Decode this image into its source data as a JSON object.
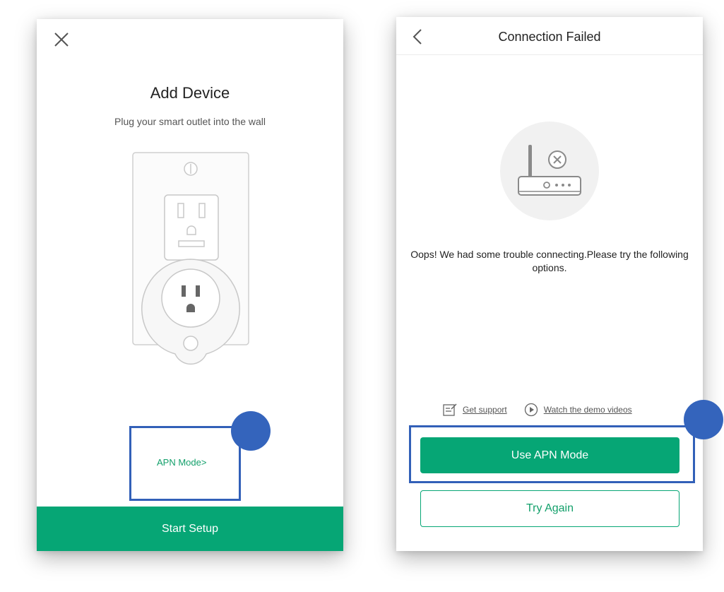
{
  "left_screen": {
    "title": "Add Device",
    "subtitle": "Plug your smart outlet into the wall",
    "apn_link": "APN Mode>",
    "start_button": "Start Setup",
    "icons": {
      "close": "close-icon",
      "illustration": "smart-outlet-illustration"
    }
  },
  "right_screen": {
    "nav_title": "Connection Failed",
    "message": "Oops! We had some trouble connecting.Please try the following options.",
    "help_links": {
      "support": "Get support",
      "demo": "Watch the demo videos"
    },
    "primary_button": "Use APN Mode",
    "secondary_button": "Try Again",
    "icons": {
      "back": "back-chevron-icon",
      "router": "router-error-icon",
      "support": "edit-note-icon",
      "demo": "play-icon"
    }
  },
  "colors": {
    "accent": "#06a675",
    "highlight": "#3260b8",
    "marker": "#3464bc"
  }
}
